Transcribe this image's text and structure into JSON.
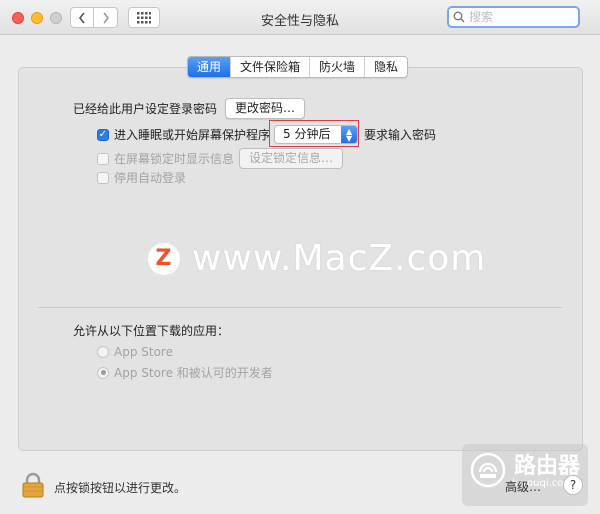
{
  "window": {
    "title": "安全性与隐私"
  },
  "search": {
    "placeholder": "搜索",
    "value": ""
  },
  "tabs": [
    {
      "label": "通用",
      "active": true
    },
    {
      "label": "文件保险箱",
      "active": false
    },
    {
      "label": "防火墙",
      "active": false
    },
    {
      "label": "隐私",
      "active": false
    }
  ],
  "general": {
    "password_label": "已经给此用户设定登录密码",
    "change_password_button": "更改密码…",
    "require_password": {
      "checked": true,
      "label": "进入睡眠或开始屏幕保护程序",
      "select_value": "5 分钟后",
      "suffix": "要求输入密码"
    },
    "show_message": {
      "checked": false,
      "label": "在屏幕锁定时显示信息",
      "button": "设定锁定信息…"
    },
    "disable_auto_login": {
      "checked": false,
      "label": "停用自动登录"
    }
  },
  "downloads": {
    "heading": "允许从以下位置下载的应用：",
    "options": [
      {
        "label": "App Store",
        "selected": false
      },
      {
        "label": "App Store 和被认可的开发者",
        "selected": true
      }
    ]
  },
  "footer": {
    "lock_text": "点按锁按钮以进行更改。",
    "advanced_label": "高级…",
    "help_label": "?"
  },
  "watermark": {
    "text": "www.MacZ.com",
    "badge": "Z"
  },
  "brand": {
    "name": "路由器",
    "sub": "luyouqi.com"
  },
  "colors": {
    "accent": "#2a7cf0",
    "highlight_box": "#d94040",
    "traffic_red": "#fe5f57",
    "traffic_yellow": "#febc2e"
  }
}
